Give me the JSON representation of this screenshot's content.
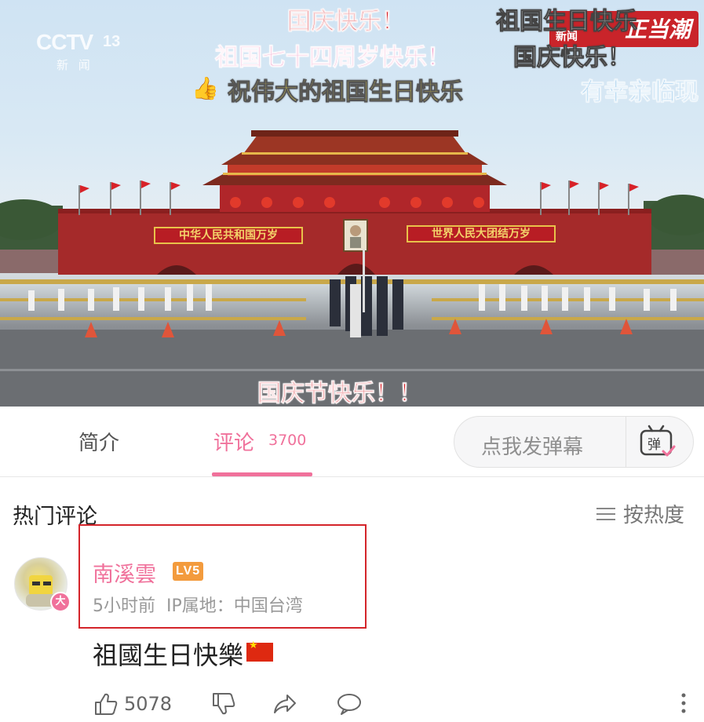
{
  "video": {
    "channel_logo": "CCTV",
    "channel_number": "13",
    "channel_sub": "新 闻",
    "news_badge": "正当潮",
    "news_badge_small": "新闻",
    "gate_sign_left": "中华人民共和国万岁",
    "gate_sign_right": "世界人民大团结万岁",
    "danmaku": [
      "国庆快乐！",
      "祖国生日快乐",
      "祖国七十四周岁快乐！",
      "国庆快乐！",
      "祝伟大的祖国生日快乐",
      "有幸亲临现",
      "国庆节快乐！！"
    ]
  },
  "tabs": {
    "intro_label": "简介",
    "comments_label": "评论",
    "comments_count": "3700",
    "danmaku_placeholder": "点我发弹幕",
    "danmaku_icon_text": "弹"
  },
  "comments_section": {
    "title": "热门评论",
    "sort_label": "按热度"
  },
  "comment": {
    "username": "南溪雲",
    "level": "LV5",
    "avatar_badge": "大",
    "time": "5小时前",
    "ip": "IP属地：中国台湾",
    "text": "祖國生日快樂",
    "likes": "5078"
  },
  "colors": {
    "accent": "#f0719b",
    "highlight_box": "#d4242a",
    "level_badge": "#f39b3d"
  }
}
